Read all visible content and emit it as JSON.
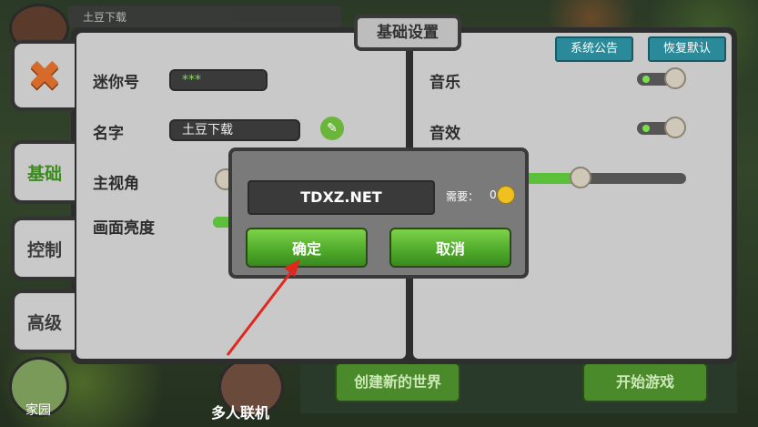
{
  "header": {
    "title": "基础设置",
    "top_name": "土豆下载"
  },
  "side_tabs": [
    {
      "label": "基础",
      "active": true
    },
    {
      "label": "控制",
      "active": false
    },
    {
      "label": "高级",
      "active": false
    }
  ],
  "settings_left": {
    "mini_id_label": "迷你号",
    "mini_id_value": "***",
    "name_label": "名字",
    "name_value": "土豆下载",
    "view_label": "主视角",
    "brightness_label": "画面亮度"
  },
  "settings_right": {
    "announce_button": "系统公告",
    "reset_button": "恢复默认",
    "music_label": "音乐",
    "music_on": true,
    "sfx_label": "音效",
    "sfx_on": true,
    "volume_level": 0.4
  },
  "dialog": {
    "input_value": "TDXZ.NET",
    "need_label": "需要：",
    "need_value": "0",
    "confirm_button": "确定",
    "cancel_button": "取消"
  },
  "bottom": {
    "home_label": "家园",
    "multiplayer_label": "多人联机",
    "create_world_button": "创建新的世界",
    "start_game_button": "开始游戏"
  },
  "colors": {
    "accent_green": "#4ea82a",
    "teal": "#2a8a9a",
    "arrow_red": "#e0281e"
  }
}
